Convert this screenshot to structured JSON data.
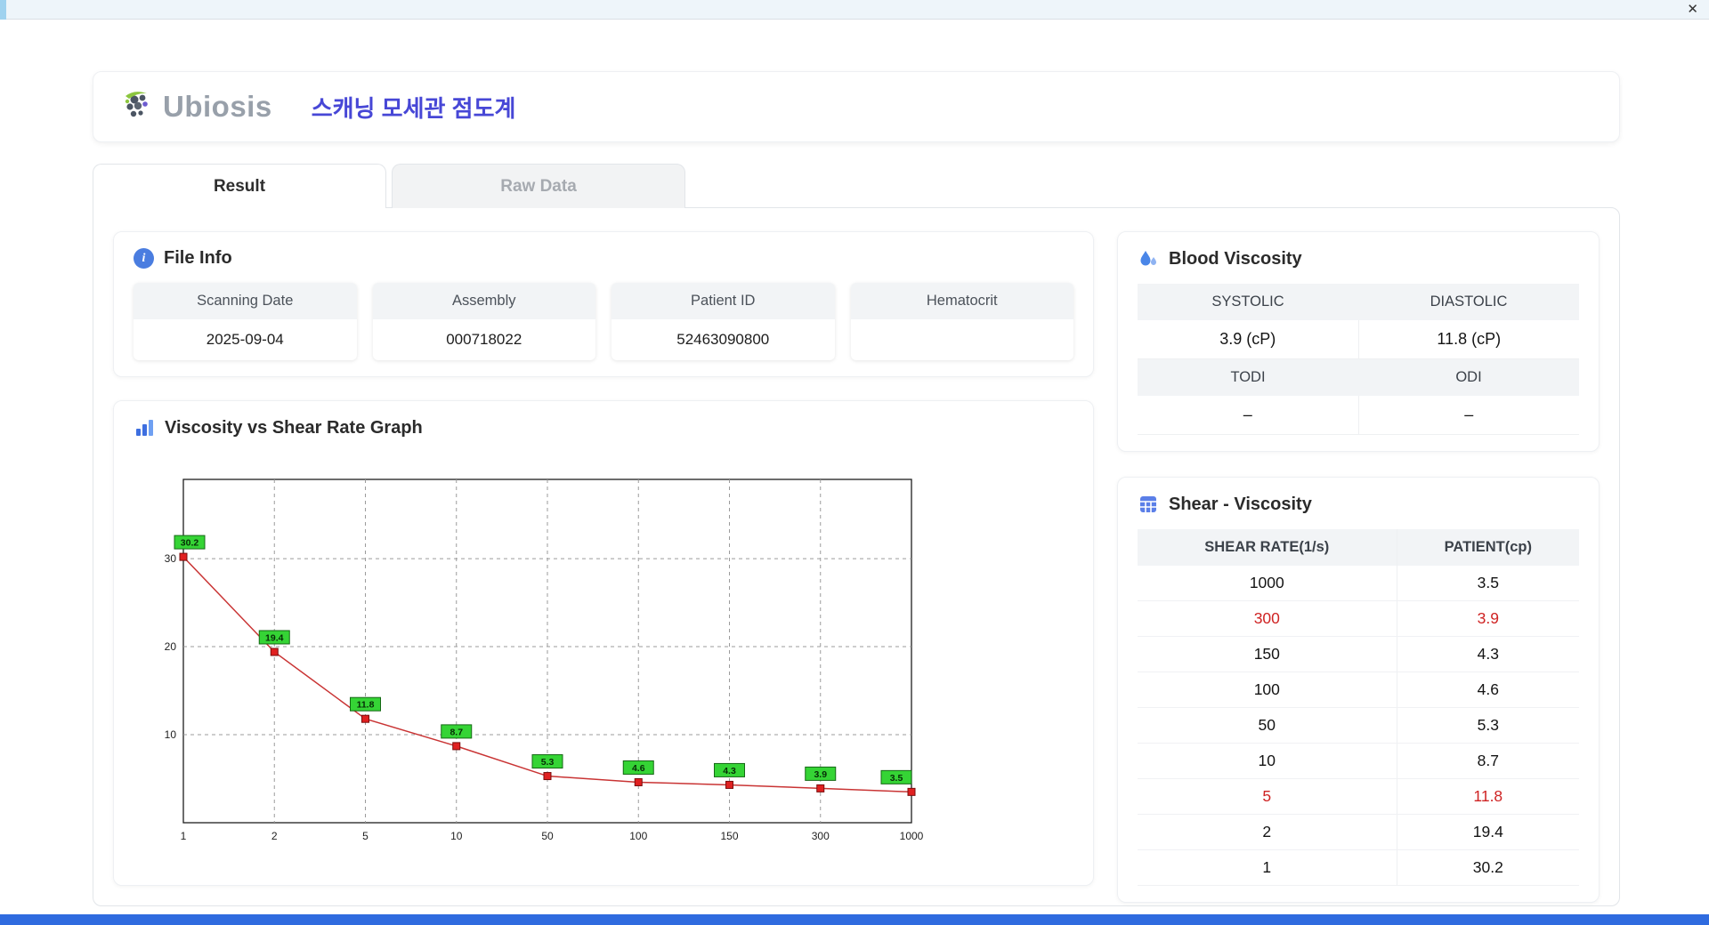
{
  "window": {
    "close_label": "✕"
  },
  "header": {
    "brand": "Ubiosis",
    "title": "스캐닝 모세관 점도계"
  },
  "tabs": [
    {
      "label": "Result",
      "active": true
    },
    {
      "label": "Raw Data",
      "active": false
    }
  ],
  "file_info": {
    "title": "File Info",
    "fields": [
      {
        "label": "Scanning Date",
        "value": "2025-09-04"
      },
      {
        "label": "Assembly",
        "value": "000718022"
      },
      {
        "label": "Patient ID",
        "value": "52463090800"
      },
      {
        "label": "Hematocrit",
        "value": ""
      }
    ]
  },
  "blood_viscosity": {
    "title": "Blood Viscosity",
    "rows": [
      {
        "labels": [
          "SYSTOLIC",
          "DIASTOLIC"
        ],
        "values": [
          "3.9 (cP)",
          "11.8 (cP)"
        ]
      },
      {
        "labels": [
          "TODI",
          "ODI"
        ],
        "values": [
          "–",
          "–"
        ]
      }
    ]
  },
  "graph": {
    "title": "Viscosity vs Shear Rate Graph"
  },
  "chart_data": {
    "type": "line",
    "title": "Viscosity vs Shear Rate Graph",
    "categories": [
      1,
      2,
      5,
      10,
      50,
      100,
      150,
      300,
      1000
    ],
    "values": [
      30.2,
      19.4,
      11.8,
      8.7,
      5.3,
      4.6,
      4.3,
      3.9,
      3.5
    ],
    "xlabel": "",
    "ylabel": "",
    "ylim": [
      0,
      39
    ],
    "yticks": [
      10,
      20,
      30
    ],
    "grid": true,
    "x_scale_note": "categories evenly spaced",
    "line_color": "#c93434",
    "marker_color": "#e02020",
    "marker_edge": "#7a0c0c",
    "label_bg": "#35d435",
    "label_edge": "#156815"
  },
  "shear_table": {
    "title": "Shear - Viscosity",
    "columns": [
      "SHEAR RATE(1/s)",
      "PATIENT(cp)"
    ],
    "rows": [
      {
        "shear": "1000",
        "patient": "3.5",
        "highlight": false
      },
      {
        "shear": "300",
        "patient": "3.9",
        "highlight": true
      },
      {
        "shear": "150",
        "patient": "4.3",
        "highlight": false
      },
      {
        "shear": "100",
        "patient": "4.6",
        "highlight": false
      },
      {
        "shear": "50",
        "patient": "5.3",
        "highlight": false
      },
      {
        "shear": "10",
        "patient": "8.7",
        "highlight": false
      },
      {
        "shear": "5",
        "patient": "11.8",
        "highlight": true
      },
      {
        "shear": "2",
        "patient": "19.4",
        "highlight": false
      },
      {
        "shear": "1",
        "patient": "30.2",
        "highlight": false
      }
    ]
  }
}
